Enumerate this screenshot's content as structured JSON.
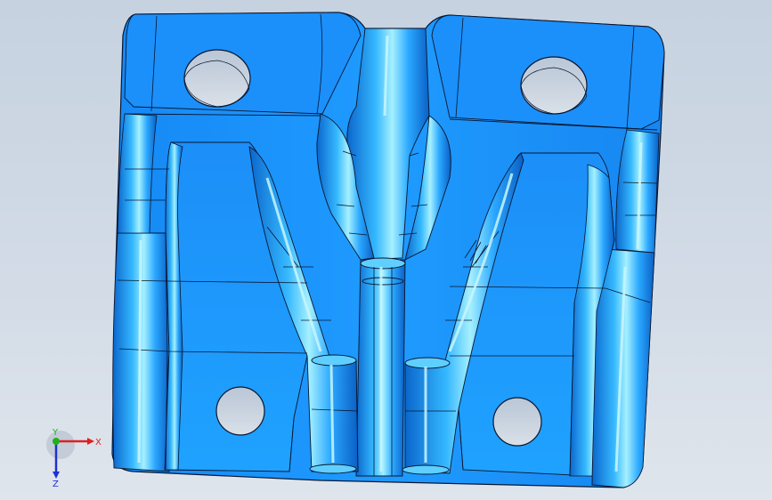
{
  "viewport": {
    "background_top": "#c6d2e0",
    "background_bottom": "#dfe5ec"
  },
  "model": {
    "kind": "mold-cavity-plate",
    "face_color": "#1e96ff",
    "shade_color": "#0c6ed8",
    "highlight_color": "#8fe6ff",
    "edge_color": "#0a1630",
    "mounting_holes": 4,
    "flow_channels": 4
  },
  "triad": {
    "x_label": "X",
    "y_label": "Y",
    "z_label": "Z",
    "x_color": "#e02020",
    "y_color": "#20b020",
    "z_color": "#2030d0"
  }
}
